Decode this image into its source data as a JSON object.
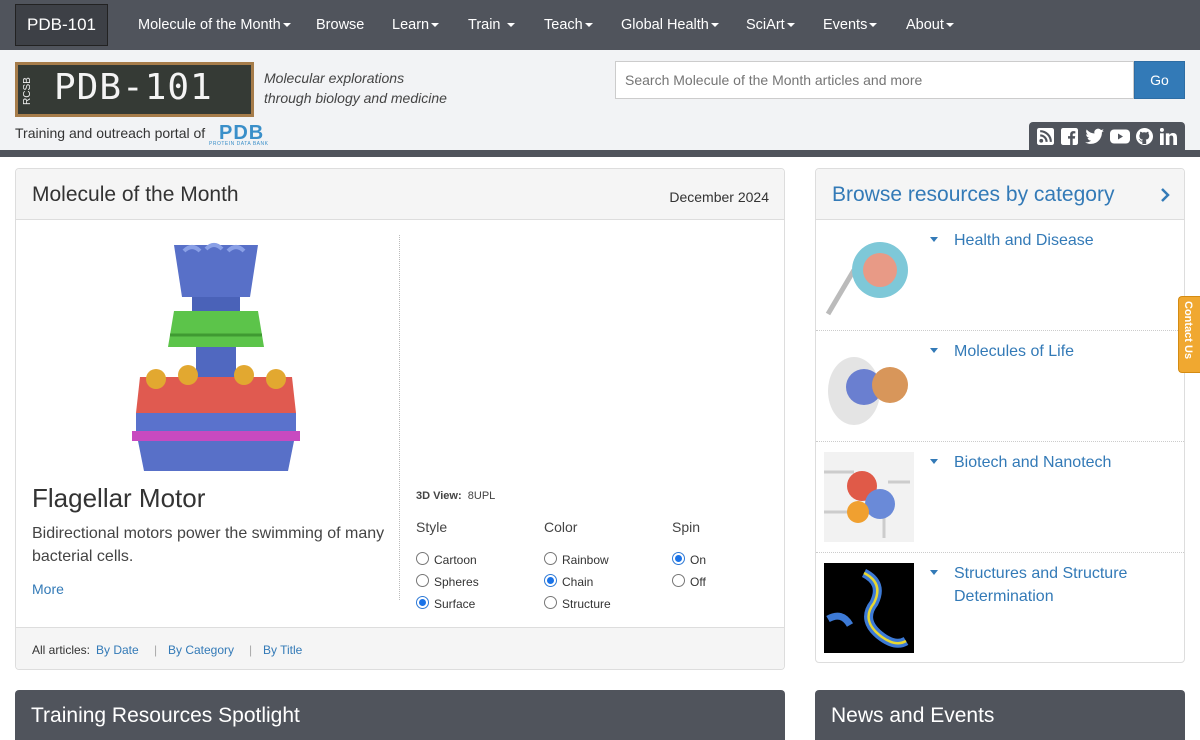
{
  "nav": {
    "brand": "PDB-101",
    "items": [
      {
        "label": "Molecule of the Month",
        "caret": true
      },
      {
        "label": "Browse",
        "caret": false
      },
      {
        "label": "Learn",
        "caret": true
      },
      {
        "label": "Train",
        "caret": true
      },
      {
        "label": "Teach",
        "caret": true
      },
      {
        "label": "Global Health",
        "caret": true
      },
      {
        "label": "SciArt",
        "caret": true
      },
      {
        "label": "Events",
        "caret": true
      },
      {
        "label": "About",
        "caret": true
      }
    ]
  },
  "header": {
    "logo_text": "PDB-101",
    "logo_rcsb": "RCSB",
    "tagline_line1": "Molecular explorations",
    "tagline_line2": "through biology and medicine",
    "portal_text": "Training and outreach portal of",
    "pdb_logo_big": "PDB",
    "pdb_logo_small": "PROTEIN DATA BANK",
    "search_placeholder": "Search Molecule of the Month articles and more",
    "search_button": "Go",
    "social_icons": [
      "rss-icon",
      "facebook-icon",
      "twitter-icon",
      "youtube-icon",
      "github-icon",
      "linkedin-icon"
    ]
  },
  "motm": {
    "title": "Molecule of the Month",
    "date": "December 2024",
    "molecule_name": "Flagellar Motor",
    "description": "Bidirectional motors power the swimming of many bacterial cells.",
    "more_label": "More",
    "view_label": "3D View:",
    "view_id": "8UPL",
    "style_head": "Style",
    "color_head": "Color",
    "spin_head": "Spin",
    "style_options": [
      {
        "label": "Cartoon",
        "checked": false
      },
      {
        "label": "Spheres",
        "checked": false
      },
      {
        "label": "Surface",
        "checked": true
      }
    ],
    "color_options": [
      {
        "label": "Rainbow",
        "checked": false
      },
      {
        "label": "Chain",
        "checked": true
      },
      {
        "label": "Structure",
        "checked": false
      }
    ],
    "spin_options": [
      {
        "label": "On",
        "checked": true
      },
      {
        "label": "Off",
        "checked": false
      }
    ],
    "footer_label": "All articles:",
    "footer_links": [
      "By Date",
      "By Category",
      "By Title"
    ],
    "footer_sep": "|"
  },
  "browse": {
    "title": "Browse resources by category",
    "categories": [
      {
        "label": "Health and Disease"
      },
      {
        "label": "Molecules of Life"
      },
      {
        "label": "Biotech and Nanotech"
      },
      {
        "label": "Structures and Structure Determination"
      }
    ]
  },
  "bottom": {
    "training_title": "Training Resources Spotlight",
    "news_title": "News and Events"
  },
  "contact_label": "Contact Us",
  "colors": {
    "nav_bg": "#50545c",
    "link": "#337ab7",
    "header_bg": "#f2f3f5",
    "contact_tab": "#f0a830"
  }
}
